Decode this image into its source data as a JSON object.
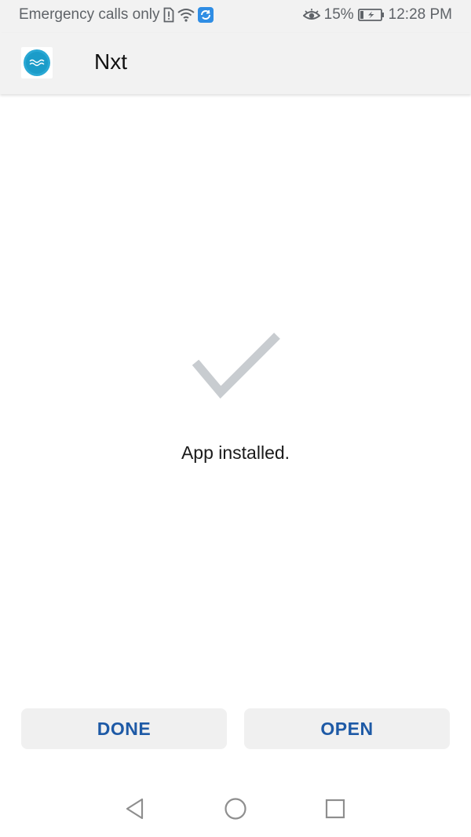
{
  "status_bar": {
    "carrier_text": "Emergency calls only",
    "battery": "15%",
    "time": "12:28 PM",
    "icons": [
      "sim-alert-icon",
      "wifi-icon",
      "sync-app-icon",
      "eye-comfort-icon",
      "battery-charging-icon"
    ]
  },
  "app_bar": {
    "app_name": "Nxt",
    "icon": "nxt-logo-icon"
  },
  "main": {
    "status_icon": "check-icon",
    "message": "App installed."
  },
  "actions": {
    "done_label": "DONE",
    "open_label": "OPEN"
  },
  "navigation": {
    "icons": [
      "back-icon",
      "home-icon",
      "recents-icon"
    ]
  },
  "colors": {
    "accent": "#1e5aa6",
    "check": "#c8ccd0",
    "bar_background": "#f2f2f2",
    "nxt_logo": "#29a8d4"
  }
}
